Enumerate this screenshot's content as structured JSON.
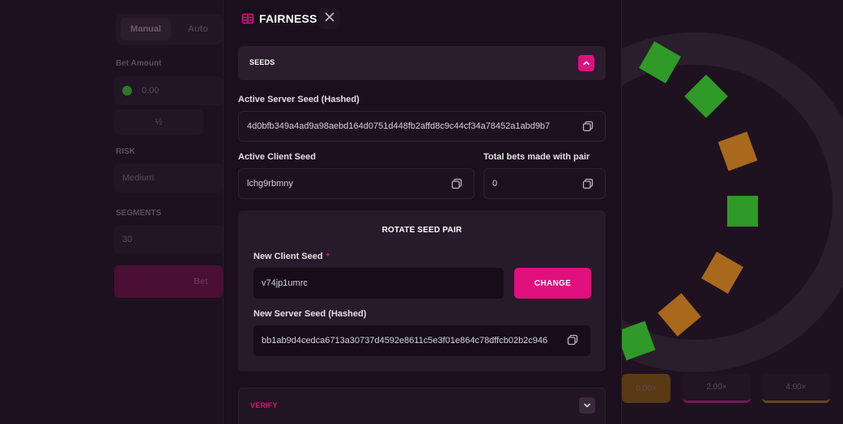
{
  "background": {
    "tabs": [
      "Manual",
      "Auto"
    ],
    "bet_amount_label": "Bet Amount",
    "bet_amount_value": "0.00",
    "half_label": "½",
    "risk_label": "RISK",
    "risk_value": "Medium",
    "segments_label": "SEGMENTS",
    "segments_value": "30",
    "bet_button": "Bet",
    "multipliers": [
      "0.00×",
      "2.00×",
      "4.00×"
    ]
  },
  "modal": {
    "title": "FAIRNESS",
    "icon": "dice-icon",
    "seeds_section": {
      "title": "SEEDS",
      "active_server_seed_label": "Active Server Seed (Hashed)",
      "active_server_seed_value": "4d0bfb349a4ad9a98aebd164d0751d448fb2affd8c9c44cf34a78452a1abd9b7",
      "active_client_seed_label": "Active Client Seed",
      "active_client_seed_value": "lchg9rbmny",
      "total_bets_label": "Total bets made with pair",
      "total_bets_value": "0"
    },
    "rotate_section": {
      "title": "ROTATE SEED PAIR",
      "new_client_seed_label": "New Client Seed",
      "required_mark": "*",
      "new_client_seed_value": "v74jp1umrc",
      "change_button": "CHANGE",
      "new_server_seed_label": "New Server Seed (Hashed)",
      "new_server_seed_value": "bb1ab9d4cedca6713a30737d4592e8611c5e3f01e864c78dffcb02b2c946"
    },
    "verify_section": {
      "title": "VERIFY"
    }
  },
  "colors": {
    "accent": "#e0107f",
    "modal_bg": "#1a0f1c",
    "panel_bg": "#271a2a",
    "wheel_green": "#2f9a27",
    "wheel_orange": "#a8691c"
  }
}
